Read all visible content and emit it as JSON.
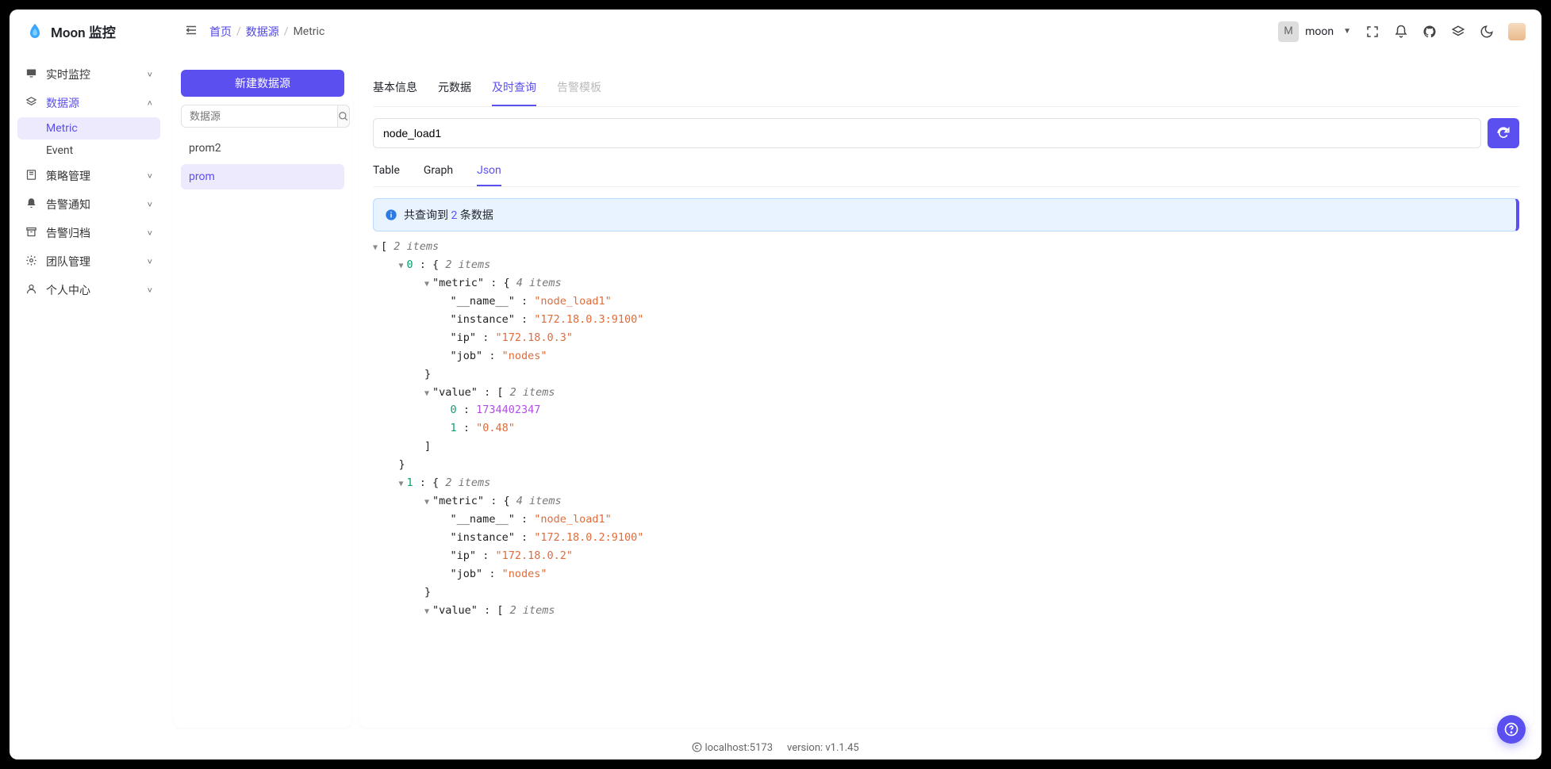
{
  "app_title": "Moon 监控",
  "breadcrumb": {
    "home": "首页",
    "ds": "数据源",
    "current": "Metric"
  },
  "user": {
    "initial": "M",
    "name": "moon"
  },
  "sidenav": {
    "items": [
      {
        "icon": "monitor",
        "label": "实时监控",
        "open": false
      },
      {
        "icon": "layers",
        "label": "数据源",
        "open": true,
        "selected": true,
        "children": [
          {
            "label": "Metric",
            "selected": true
          },
          {
            "label": "Event",
            "selected": false
          }
        ]
      },
      {
        "icon": "book",
        "label": "策略管理",
        "open": false
      },
      {
        "icon": "bell",
        "label": "告警通知",
        "open": false
      },
      {
        "icon": "archive",
        "label": "告警归档",
        "open": false
      },
      {
        "icon": "gear",
        "label": "团队管理",
        "open": false
      },
      {
        "icon": "user",
        "label": "个人中心",
        "open": false
      }
    ]
  },
  "ds_panel": {
    "new_btn": "新建数据源",
    "search_placeholder": "数据源",
    "items": [
      {
        "label": "prom2",
        "selected": false
      },
      {
        "label": "prom",
        "selected": true
      }
    ]
  },
  "tabs": [
    {
      "label": "基本信息",
      "active": false
    },
    {
      "label": "元数据",
      "active": false
    },
    {
      "label": "及时查询",
      "active": true
    },
    {
      "label": "告警模板",
      "disabled": true
    }
  ],
  "query_text": "node_load1",
  "subtabs": [
    {
      "label": "Table",
      "active": false
    },
    {
      "label": "Graph",
      "active": false
    },
    {
      "label": "Json",
      "active": true
    }
  ],
  "alert": {
    "prefix": "共查询到 ",
    "count": "2",
    "suffix": " 条数据"
  },
  "json_result": {
    "top_items_label": "2 items",
    "records": [
      {
        "idx": "0",
        "items_label": "2 items",
        "metric_items_label": "4 items",
        "metric": {
          "__name__": "node_load1",
          "instance": "172.18.0.3:9100",
          "ip": "172.18.0.3",
          "job": "nodes"
        },
        "value_items_label": "2 items",
        "value": {
          "ts": "1734402347",
          "val": "0.48"
        }
      },
      {
        "idx": "1",
        "items_label": "2 items",
        "metric_items_label": "4 items",
        "metric": {
          "__name__": "node_load1",
          "instance": "172.18.0.2:9100",
          "ip": "172.18.0.2",
          "job": "nodes"
        },
        "value_items_label": "2 items"
      }
    ]
  },
  "footer": {
    "host": "localhost:5173",
    "version": "version: v1.1.45"
  }
}
